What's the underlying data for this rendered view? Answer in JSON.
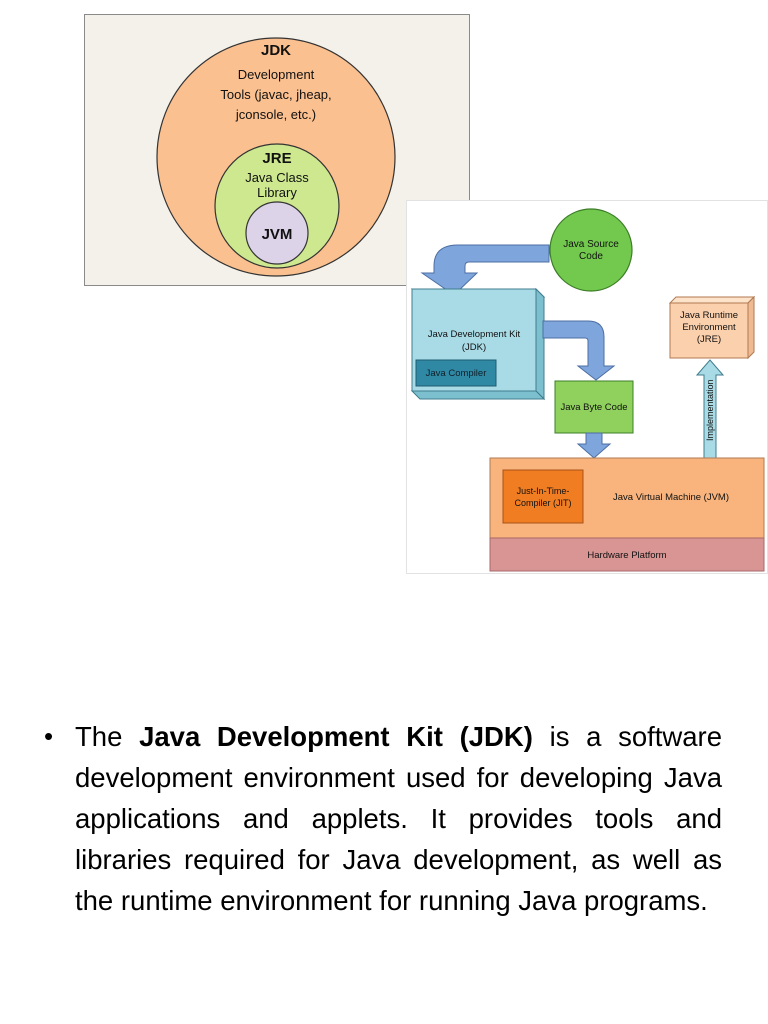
{
  "venn_diagram": {
    "jdk": {
      "title": "JDK",
      "line1": "Development",
      "line2": "Tools (javac, jheap,",
      "line3": "jconsole, etc.)"
    },
    "jre": {
      "title": "JRE",
      "line1": "Java Class",
      "line2": "Library"
    },
    "jvm": {
      "title": "JVM"
    }
  },
  "flow_diagram": {
    "source_code": {
      "line1": "Java Source",
      "line2": "Code"
    },
    "jdk_box": {
      "line1": "Java Development Kit",
      "line2": "(JDK)"
    },
    "compiler": "Java Compiler",
    "byte_code": "Java Byte Code",
    "jre_box": {
      "line1": "Java Runtime",
      "line2": "Environment",
      "line3": "(JRE)"
    },
    "implementation": "Implementation",
    "jit": {
      "line1": "Just-In-Time-",
      "line2": "Compiler (JIT)"
    },
    "jvm_label": "Java Virtual Machine (JVM)",
    "hardware": "Hardware Platform"
  },
  "bullet": {
    "symbol": "•",
    "lead": "The ",
    "term": "Java Development Kit (JDK)",
    "rest": " is a software development environment used for developing Java applications and applets. It provides tools and libraries required for Java development, as well as the runtime environment for running Java programs."
  }
}
